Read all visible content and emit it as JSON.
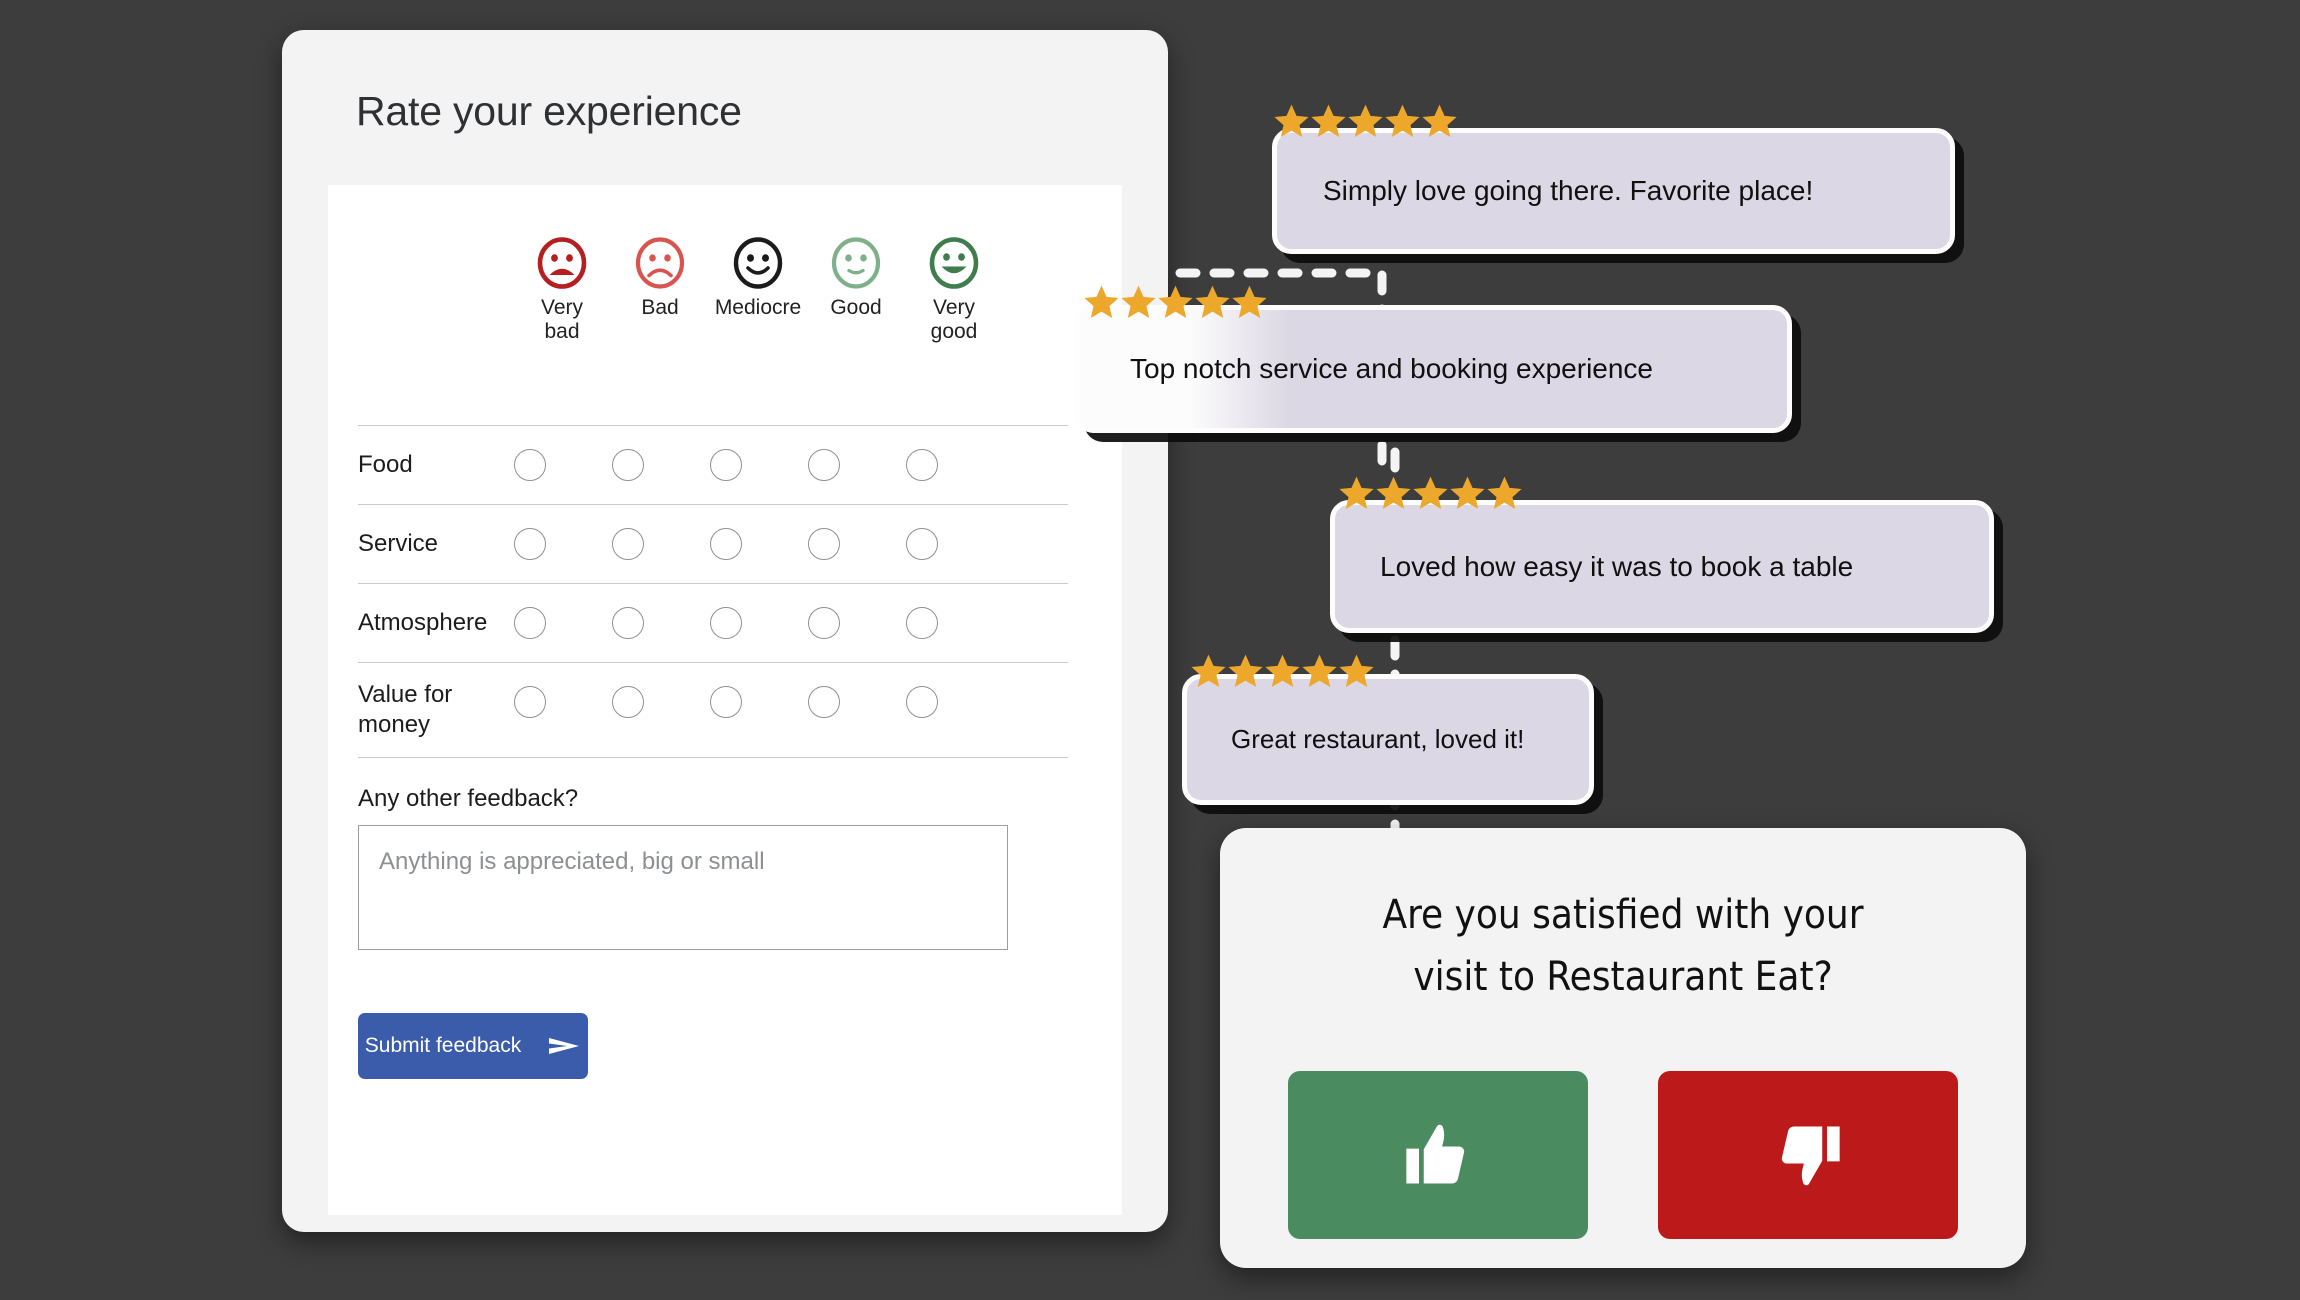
{
  "colors": {
    "page_background": "#3d3d3d",
    "card_background": "#f3f3f3",
    "panel_background": "#ffffff",
    "submit_blue": "#3b5bab",
    "star_gold": "#eda82c",
    "bubble_lavender": "#dcd7e4",
    "thumbs_up_green": "#4a8b5f",
    "thumbs_down_red": "#bc1a1a",
    "face_very_bad": "#b61f22",
    "face_bad": "#d9534f",
    "face_mediocre": "#1b1b1b",
    "face_good": "#7fb08a",
    "face_very_good": "#4a8b5f"
  },
  "form": {
    "title": "Rate your experience",
    "scale": [
      {
        "label_line1": "Very",
        "label_line2": "bad",
        "icon": "frown-open-face-icon",
        "color": "#b61f22"
      },
      {
        "label_line1": "Bad",
        "label_line2": "",
        "icon": "frown-face-icon",
        "color": "#d9534f"
      },
      {
        "label_line1": "Mediocre",
        "label_line2": "",
        "icon": "slight-smile-face-icon",
        "color": "#1b1b1b"
      },
      {
        "label_line1": "Good",
        "label_line2": "",
        "icon": "neutral-smile-face-icon",
        "color": "#7fb08a"
      },
      {
        "label_line1": "Very",
        "label_line2": "good",
        "icon": "grin-face-icon",
        "color": "#4a8b5f"
      }
    ],
    "criteria": [
      {
        "label_line1": "Food",
        "label_line2": ""
      },
      {
        "label_line1": "Service",
        "label_line2": ""
      },
      {
        "label_line1": "Atmosphere",
        "label_line2": ""
      },
      {
        "label_line1": "Value for",
        "label_line2": "money"
      }
    ],
    "feedback_question": "Any other feedback?",
    "feedback_placeholder": "Anything is appreciated, big or small",
    "feedback_value": "",
    "submit_label": "Submit feedback",
    "submit_icon": "send-arrow-icon"
  },
  "reviews": [
    {
      "text": "Simply love going there. Favorite place!",
      "stars": 5
    },
    {
      "text": "Top notch service and booking experience",
      "stars": 5
    },
    {
      "text": "Loved how easy it was to book a table",
      "stars": 5
    },
    {
      "text": "Great restaurant, loved it!",
      "stars": 5
    }
  ],
  "satisfaction": {
    "question": "Are you satisfied with your visit to Restaurant Eat?",
    "question_line1": "Are you satisfied with your",
    "question_line2": "visit to Restaurant Eat?",
    "yes_icon": "thumbs-up-icon",
    "no_icon": "thumbs-down-icon"
  }
}
